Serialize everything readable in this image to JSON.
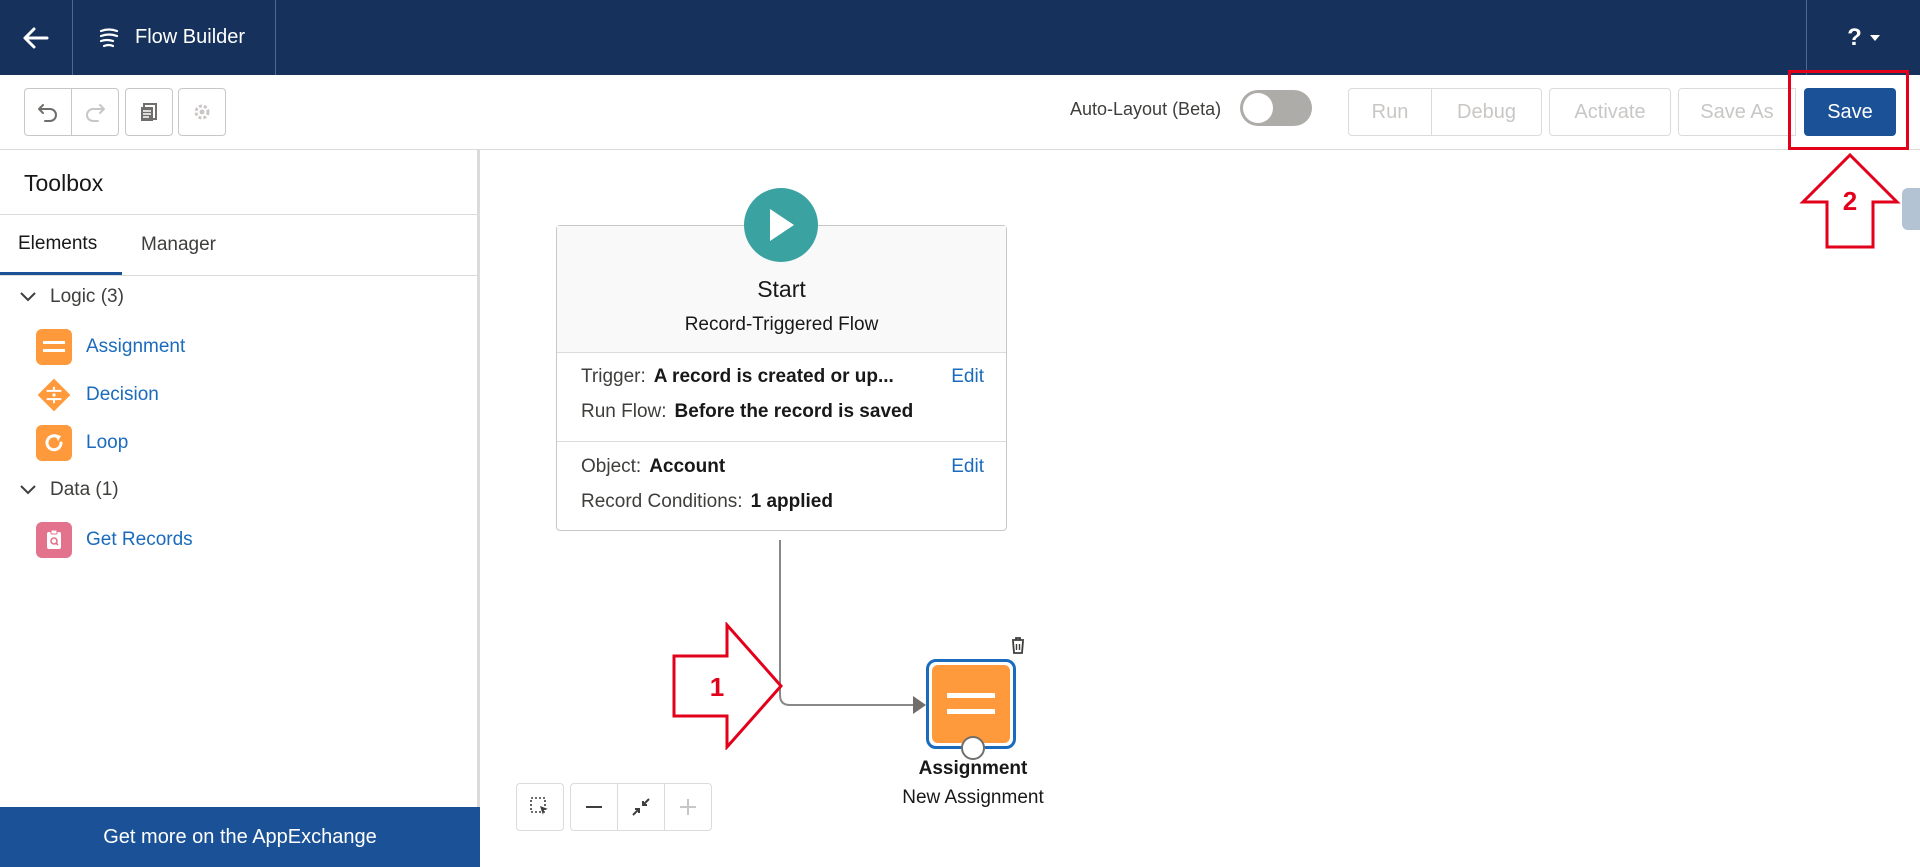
{
  "topbar": {
    "app_title": "Flow Builder",
    "help_label": "?"
  },
  "toolbar": {
    "auto_layout_label": "Auto-Layout (Beta)",
    "auto_layout_on": false,
    "run_label": "Run",
    "debug_label": "Debug",
    "activate_label": "Activate",
    "save_as_label": "Save As",
    "save_label": "Save"
  },
  "sidebar": {
    "title": "Toolbox",
    "tabs": [
      {
        "label": "Elements"
      },
      {
        "label": "Manager"
      }
    ],
    "categories": [
      {
        "label": "Logic (3)",
        "items": [
          {
            "label": "Assignment"
          },
          {
            "label": "Decision"
          },
          {
            "label": "Loop"
          }
        ]
      },
      {
        "label": "Data (1)",
        "items": [
          {
            "label": "Get Records"
          }
        ]
      }
    ],
    "appexchange_label": "Get more on the AppExchange"
  },
  "start": {
    "title": "Start",
    "subtitle": "Record-Triggered Flow",
    "trigger_label": "Trigger:",
    "trigger_value": "A record is created or up...",
    "run_flow_label": "Run Flow:",
    "run_flow_value": "Before the record is saved",
    "object_label": "Object:",
    "object_value": "Account",
    "conditions_label": "Record Conditions:",
    "conditions_value": "1 applied",
    "edit_label": "Edit"
  },
  "node": {
    "type_label": "Assignment",
    "name_label": "New Assignment"
  },
  "annotations": {
    "arrow1": "1",
    "arrow2": "2"
  },
  "colors": {
    "header": "#16325c",
    "brand_blue": "#1b5297",
    "link": "#1b6bbd",
    "orange": "#ff9a3c",
    "teal": "#3ba2a2",
    "pink": "#e3738d",
    "annotation_red": "#e3001b"
  }
}
